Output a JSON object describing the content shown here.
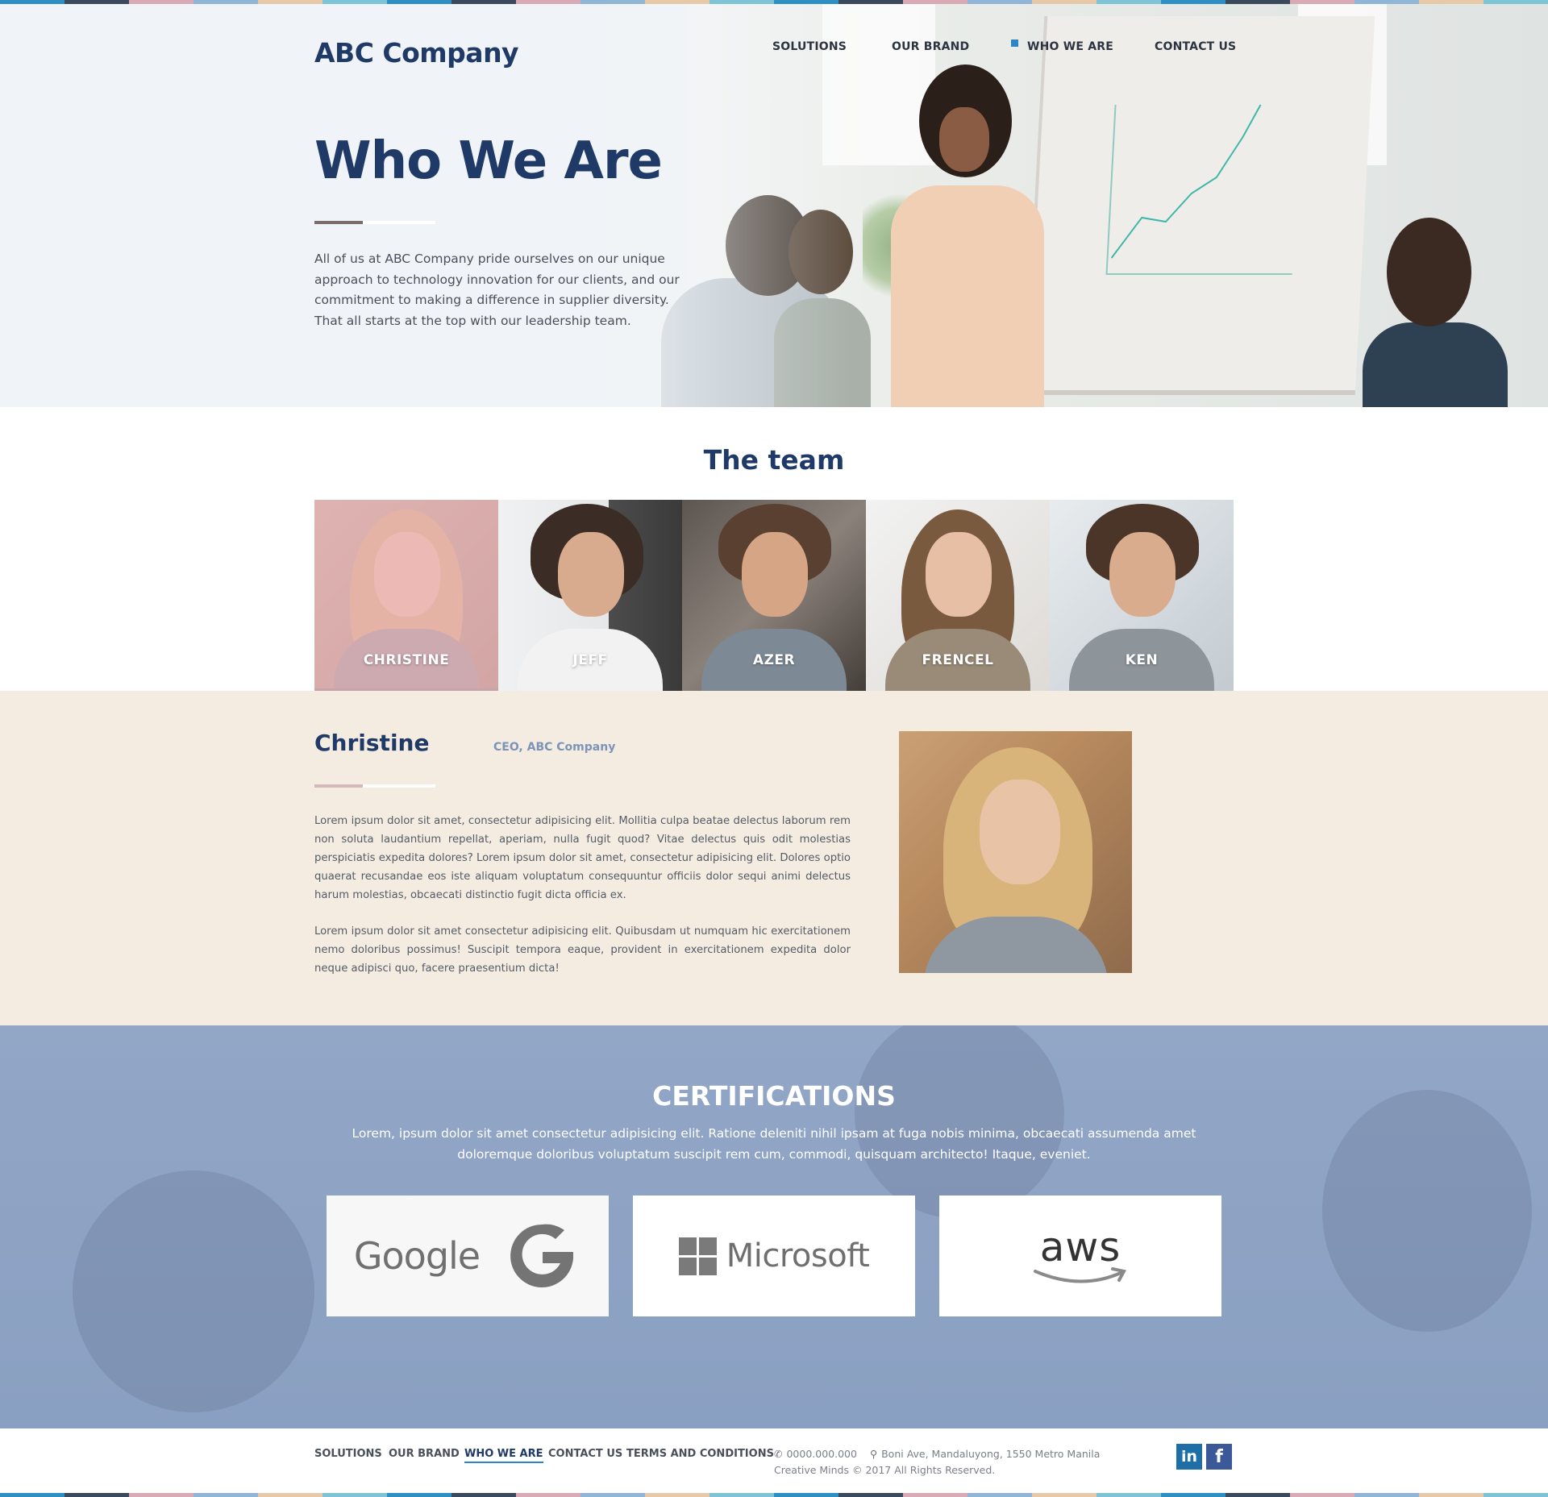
{
  "brand": {
    "name": "ABC Company"
  },
  "nav": {
    "items": [
      {
        "label": "SOLUTIONS"
      },
      {
        "label": "OUR BRAND"
      },
      {
        "label": "WHO WE ARE"
      },
      {
        "label": "CONTACT US"
      }
    ],
    "active": "WHO WE ARE"
  },
  "hero": {
    "title": "Who We Are",
    "text": "All of us at ABC Company pride ourselves on our unique approach to technology innovation for our clients, and our commitment to making a difference in supplier diversity. That all starts at the top with our leadership team."
  },
  "team": {
    "title": "The team",
    "members": [
      {
        "name": "CHRISTINE",
        "active": true
      },
      {
        "name": "JEFF"
      },
      {
        "name": "AZER"
      },
      {
        "name": "FRENCEL"
      },
      {
        "name": "KEN"
      }
    ]
  },
  "profile": {
    "name": "Christine",
    "role": "CEO, ABC Company",
    "paragraphs": [
      "Lorem ipsum dolor sit amet, consectetur adipisicing elit. Mollitia culpa beatae delectus laborum rem non soluta laudantium repellat, aperiam, nulla fugit quod? Vitae delectus quis odit molestias perspiciatis expedita dolores? Lorem ipsum dolor sit amet, consectetur adipisicing elit. Dolores optio quaerat recusandae eos iste aliquam voluptatum consequuntur officiis dolor sequi animi delectus harum molestias, obcaecati distinctio fugit dicta officia ex.",
      "Lorem ipsum dolor sit amet consectetur adipisicing elit. Quibusdam ut numquam hic exercitationem nemo doloribus possimus! Suscipit tempora eaque, provident in exercitationem expedita dolor neque adipisci quo, facere praesentium dicta!"
    ]
  },
  "certifications": {
    "title": "CERTIFICATIONS",
    "text": "Lorem, ipsum dolor sit amet consectetur adipisicing elit. Ratione deleniti nihil ipsam at fuga nobis minima, obcaecati assumenda amet doloremque doloribus voluptatum suscipit rem cum, commodi, quisquam architecto! Itaque, eveniet.",
    "logos": [
      {
        "name": "Google",
        "icon": "google-g-icon"
      },
      {
        "name": "Microsoft",
        "icon": "microsoft-grid-icon"
      },
      {
        "name": "aws",
        "icon": "amazon-smile-icon"
      }
    ]
  },
  "footer": {
    "links": [
      {
        "label": "SOLUTIONS"
      },
      {
        "label": "OUR BRAND"
      },
      {
        "label": "WHO WE ARE"
      },
      {
        "label": "CONTACT US"
      },
      {
        "label": "TERMS AND CONDITIONS"
      }
    ],
    "phone": "0000.000.000",
    "address": "Boni Ave, Mandaluyong, 1550 Metro Manila",
    "copyright": "Creative Minds © 2017 All Rights Reserved.",
    "social": [
      {
        "label": "in",
        "icon": "linkedin-icon"
      },
      {
        "label": "f",
        "icon": "facebook-icon"
      }
    ]
  },
  "colors": {
    "brand_navy": "#1f3a66",
    "accent_blue": "#2a86c7",
    "profile_bg": "#f4ece1",
    "cert_bg": "#8ea3c4",
    "stripe": [
      "#2d8fc4",
      "#3a4a5c",
      "#d9a9b6",
      "#8fb6d6",
      "#e7c9a7",
      "#7fc3d6"
    ]
  }
}
